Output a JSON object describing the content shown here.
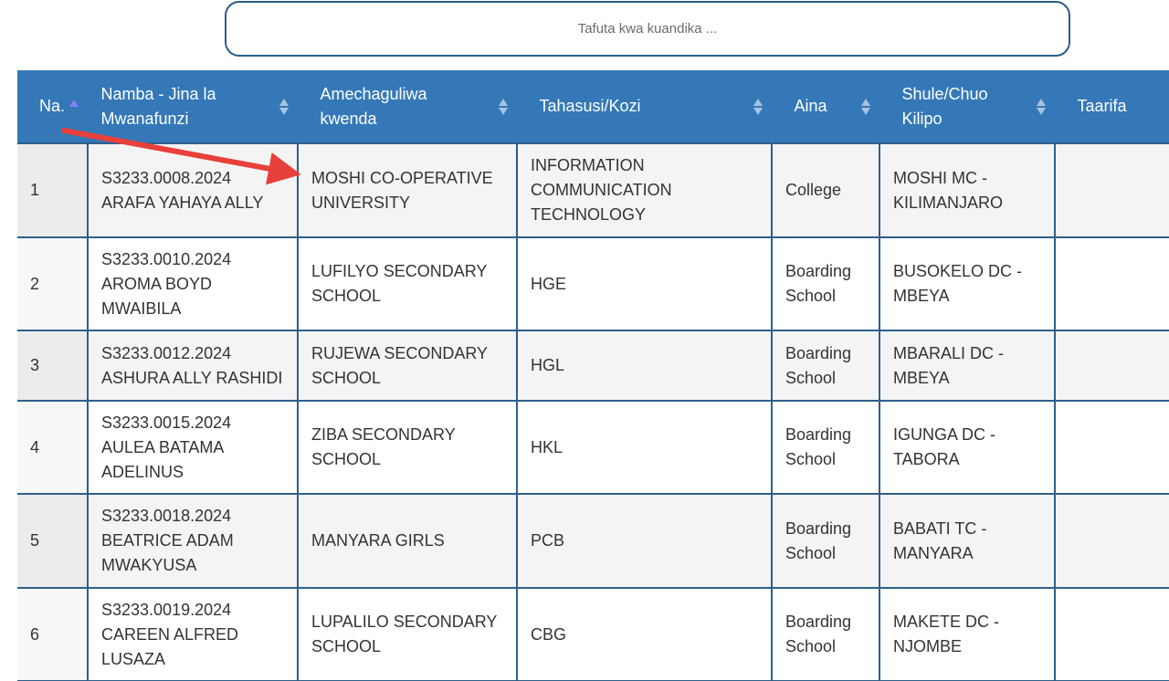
{
  "search": {
    "placeholder": "Tafuta kwa kuandika ..."
  },
  "table": {
    "headers": [
      {
        "label": "Na."
      },
      {
        "label": "Namba - Jina la Mwanafunzi"
      },
      {
        "label": "Amechaguliwa kwenda"
      },
      {
        "label": "Tahasusi/Kozi"
      },
      {
        "label": "Aina"
      },
      {
        "label": "Shule/Chuo Kilipo"
      },
      {
        "label": "Taarifa"
      }
    ],
    "rows": [
      {
        "na": "1",
        "student": "S3233.0008.2024 ARAFA YAHAYA ALLY",
        "selected_to": "MOSHI CO-OPERATIVE UNIVERSITY",
        "course": "INFORMATION COMMUNICATION TECHNOLOGY",
        "type": "College",
        "location": "MOSHI MC - KILIMANJARO",
        "info": ""
      },
      {
        "na": "2",
        "student": "S3233.0010.2024 AROMA BOYD MWAIBILA",
        "selected_to": "LUFILYO SECONDARY SCHOOL",
        "course": "HGE",
        "type": "Boarding School",
        "location": "BUSOKELO DC - MBEYA",
        "info": ""
      },
      {
        "na": "3",
        "student": "S3233.0012.2024 ASHURA ALLY RASHIDI",
        "selected_to": "RUJEWA SECONDARY SCHOOL",
        "course": "HGL",
        "type": "Boarding School",
        "location": "MBARALI DC - MBEYA",
        "info": ""
      },
      {
        "na": "4",
        "student": "S3233.0015.2024 AULEA BATAMA ADELINUS",
        "selected_to": "ZIBA SECONDARY SCHOOL",
        "course": "HKL",
        "type": "Boarding School",
        "location": "IGUNGA DC - TABORA",
        "info": ""
      },
      {
        "na": "5",
        "student": "S3233.0018.2024 BEATRICE ADAM MWAKYUSA",
        "selected_to": "MANYARA GIRLS",
        "course": "PCB",
        "type": "Boarding School",
        "location": "BABATI TC - MANYARA",
        "info": ""
      },
      {
        "na": "6",
        "student": "S3233.0019.2024 CAREEN ALFRED LUSAZA",
        "selected_to": "LUPALILO SECONDARY SCHOOL",
        "course": "CBG",
        "type": "Boarding School",
        "location": "MAKETE DC - NJOMBE",
        "info": ""
      }
    ]
  },
  "colors": {
    "header_bg": "#3478b8",
    "border": "#2e5f8c",
    "link": "#3b7dbf",
    "annotation_arrow": "#e8403a"
  }
}
